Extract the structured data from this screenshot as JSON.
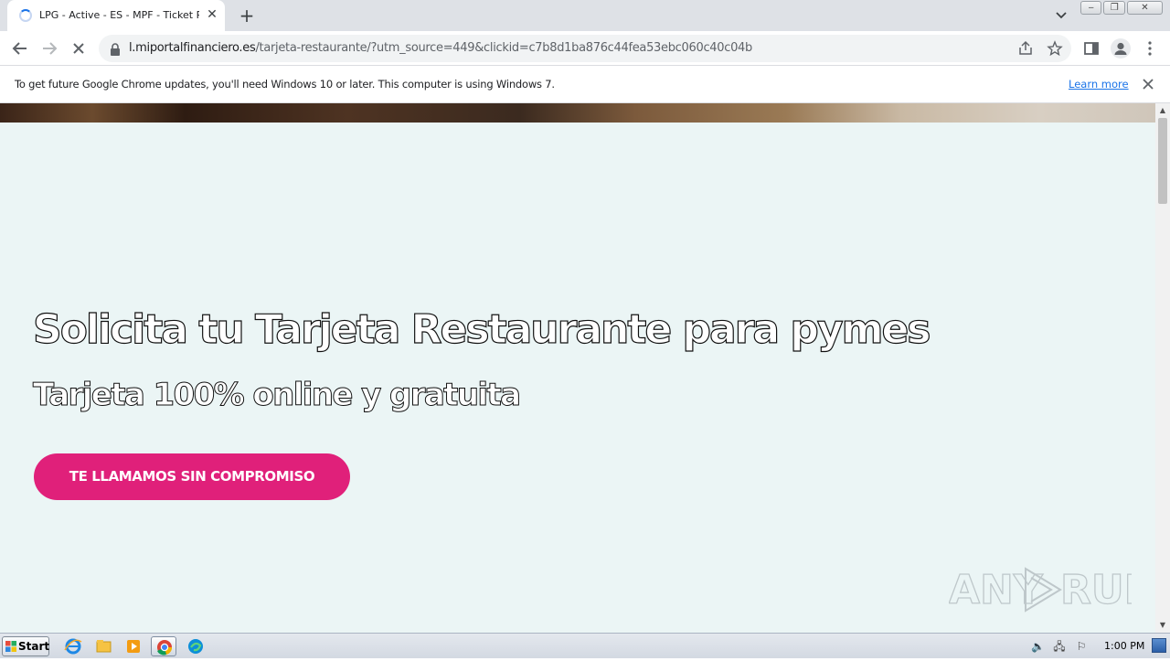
{
  "browser": {
    "tab": {
      "title": "LPG - Active - ES - MPF - Ticket Restaurante",
      "close_glyph": "✕"
    },
    "new_tab_glyph": "+",
    "address": {
      "host": "l.miportalfinanciero.es",
      "path": "/tarjeta-restaurante/?utm_source=449&clickid=c7b8d1ba876c44fea53ebc060c40c04b"
    },
    "icons": {
      "back": "back-arrow-icon",
      "forward": "forward-arrow-icon",
      "reload": "stop-loading-icon",
      "share": "share-icon",
      "bookmark": "star-icon",
      "side_panel": "side-panel-icon",
      "profile": "profile-icon",
      "menu": "kebab-menu-icon"
    }
  },
  "infobar": {
    "message": "To get future Google Chrome updates, you'll need Windows 10 or later. This computer is using Windows 7.",
    "link": "Learn more"
  },
  "page": {
    "title": "Solicita tu Tarjeta Restaurante para pymes",
    "subtitle": "Tarjeta 100% online y gratuita",
    "cta": "TE LLAMAMOS SIN COMPROMISO",
    "accent_color": "#e0207a",
    "background_color": "#ebf5f5",
    "watermark": "ANY RUN"
  },
  "taskbar": {
    "start": "Start",
    "clock": "1:00 PM"
  }
}
